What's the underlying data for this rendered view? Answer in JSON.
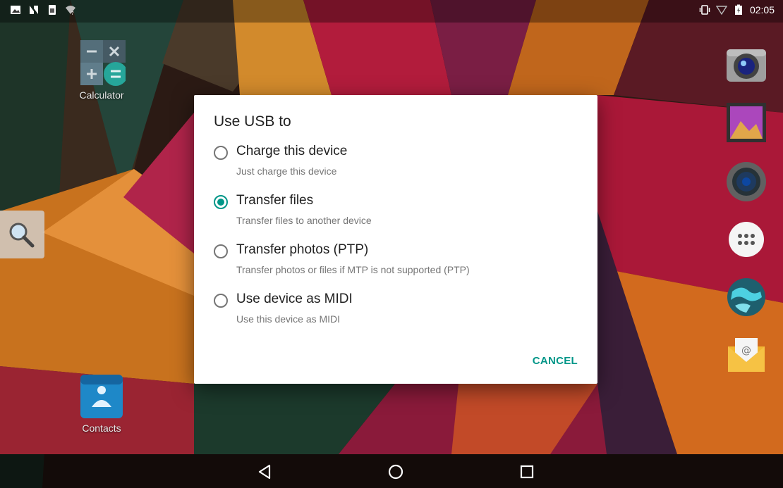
{
  "status_bar": {
    "time": "02:05",
    "left_icons": [
      "image-icon",
      "n-notification-icon",
      "sim-icon",
      "wifi-unknown-icon"
    ],
    "right_icons": [
      "vibrate-icon",
      "signal-icon",
      "battery-icon"
    ]
  },
  "desktop": {
    "apps": [
      {
        "label": "Calculator",
        "icon": "calculator-icon"
      },
      {
        "label": "Contacts",
        "icon": "contacts-icon"
      }
    ],
    "dock_icons": [
      "camera-icon",
      "gallery-icon",
      "music-icon",
      "app-drawer-icon",
      "browser-icon",
      "email-icon"
    ],
    "search_icon": "search-icon"
  },
  "dialog": {
    "title": "Use USB to",
    "options": [
      {
        "title": "Charge this device",
        "subtitle": "Just charge this device",
        "selected": false
      },
      {
        "title": "Transfer files",
        "subtitle": "Transfer files to another device",
        "selected": true
      },
      {
        "title": "Transfer photos (PTP)",
        "subtitle": "Transfer photos or files if MTP is not supported (PTP)",
        "selected": false
      },
      {
        "title": "Use device as MIDI",
        "subtitle": "Use this device as MIDI",
        "selected": false
      }
    ],
    "cancel_label": "CANCEL",
    "accent_color": "#009688"
  },
  "navigation": {
    "buttons": [
      "back-icon",
      "home-icon",
      "recents-icon"
    ]
  }
}
